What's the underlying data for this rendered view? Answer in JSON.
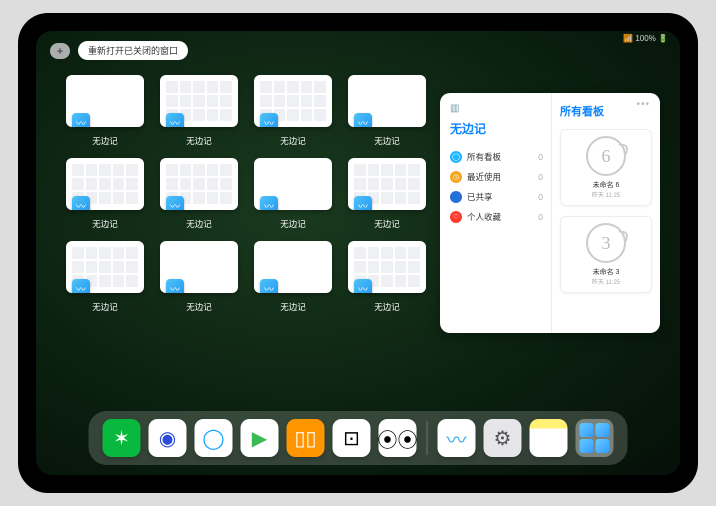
{
  "status": "📶 100% 🔋",
  "topbar": {
    "plus": "+",
    "pill_label": "重新打开已关闭的窗口"
  },
  "tile_app_label": "无边记",
  "tiles": [
    {
      "style": "blank"
    },
    {
      "style": "cal_stack"
    },
    {
      "style": "cal_stack"
    },
    {
      "style": "blank"
    },
    {
      "style": "cal"
    },
    {
      "style": "cal"
    },
    {
      "style": "blank"
    },
    {
      "style": "cal"
    },
    {
      "style": "cal_stack"
    },
    {
      "style": "blank"
    },
    {
      "style": "blank"
    },
    {
      "style": "cal_stack"
    }
  ],
  "panel": {
    "title": "无边记",
    "right_title": "所有看板",
    "nav": [
      {
        "color": "#1fb6ff",
        "icon": "◯",
        "label": "所有看板",
        "count": "0"
      },
      {
        "color": "#f5a623",
        "icon": "◷",
        "label": "最近使用",
        "count": "0"
      },
      {
        "color": "#2d6cdf",
        "icon": "👤",
        "label": "已共享",
        "count": "0"
      },
      {
        "color": "#ff3b30",
        "icon": "♡",
        "label": "个人收藏",
        "count": "0"
      }
    ],
    "boards": [
      {
        "glyph": "6",
        "label": "未命名 6",
        "sub": "昨天 11:25"
      },
      {
        "glyph": "3",
        "label": "未命名 3",
        "sub": "昨天 11:25"
      }
    ]
  },
  "dock": [
    {
      "name": "wechat",
      "bg": "#09b83e",
      "glyph": "✶",
      "color": "#fff"
    },
    {
      "name": "quark",
      "bg": "#fff",
      "glyph": "◉",
      "color": "#2c4bd8"
    },
    {
      "name": "qqbrowser",
      "bg": "#fff",
      "glyph": "◯",
      "color": "#16a4ff"
    },
    {
      "name": "play",
      "bg": "#fff",
      "glyph": "▶",
      "color": "#3cba54"
    },
    {
      "name": "books",
      "bg": "#ff9500",
      "glyph": "▯▯",
      "color": "#fff"
    },
    {
      "name": "dice",
      "bg": "#fff",
      "glyph": "⊡",
      "color": "#000"
    },
    {
      "name": "share",
      "bg": "#fff",
      "glyph": "⦿⦿",
      "color": "#000"
    }
  ],
  "dock_recent": [
    {
      "name": "freeform",
      "bg": "#fff",
      "glyph": "〰",
      "color": "#2aa9f0"
    },
    {
      "name": "settings",
      "bg": "#e5e5ea",
      "glyph": "⚙",
      "color": "#555"
    },
    {
      "name": "notes",
      "bg": "linear-gradient(#fff176 25%,#fff 25%)",
      "glyph": "",
      "color": "#000"
    }
  ]
}
